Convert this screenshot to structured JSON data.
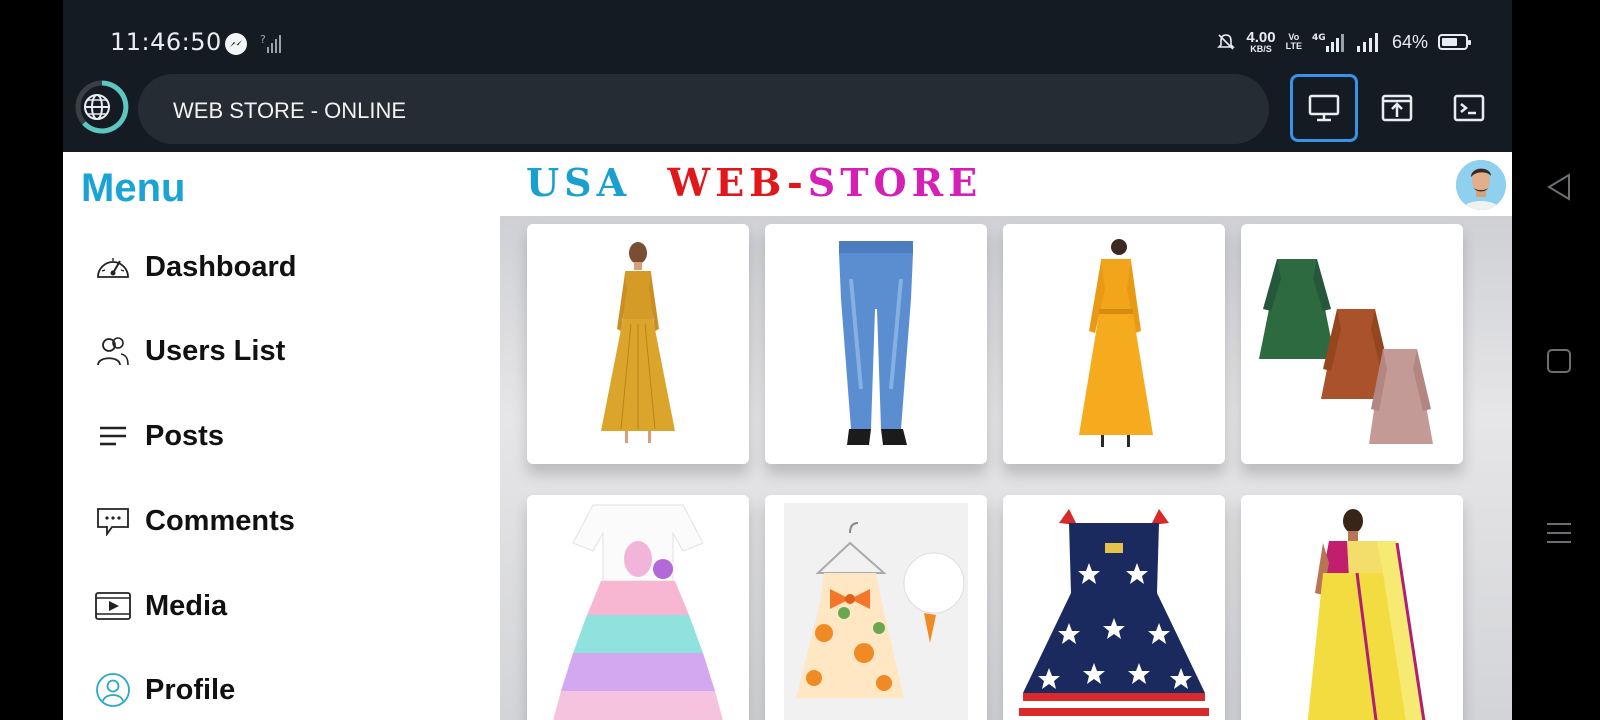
{
  "status_bar": {
    "time": "11:46:50",
    "net_speed_value": "4.00",
    "net_speed_unit": "KB/S",
    "volte_top": "Vo",
    "volte_bottom": "LTE",
    "network_type": "4G",
    "battery": "64%"
  },
  "browser": {
    "url_text": "WEB STORE - ONLINE",
    "buttons": [
      "desktop-view",
      "share",
      "terminal"
    ]
  },
  "sidebar": {
    "title": "Menu",
    "items": [
      {
        "label": "Dashboard",
        "icon": "speedometer-icon"
      },
      {
        "label": "Users List",
        "icon": "users-icon"
      },
      {
        "label": "Posts",
        "icon": "lines-icon"
      },
      {
        "label": "Comments",
        "icon": "comment-icon"
      },
      {
        "label": "Media",
        "icon": "film-icon"
      },
      {
        "label": "Profile",
        "icon": "user-circle-icon"
      }
    ]
  },
  "store": {
    "brand_usa": "USA",
    "brand_web": "WEB",
    "brand_dash": "-",
    "brand_store": "STORE",
    "products": [
      {
        "name": "mustard-maxi-dress"
      },
      {
        "name": "blue-jeans"
      },
      {
        "name": "yellow-dress"
      },
      {
        "name": "kids-ruffle-dresses"
      },
      {
        "name": "rainbow-tutu-dress"
      },
      {
        "name": "floral-baby-dress-with-hat"
      },
      {
        "name": "stars-and-stripes-dress"
      },
      {
        "name": "yellow-saree"
      }
    ]
  },
  "colors": {
    "menu_title": "#1aa3d6",
    "brand_usa": "#1aa0cf",
    "brand_web": "#e0171b",
    "brand_store": "#d51fb6",
    "active_toolbar_border": "#3a93e8"
  }
}
